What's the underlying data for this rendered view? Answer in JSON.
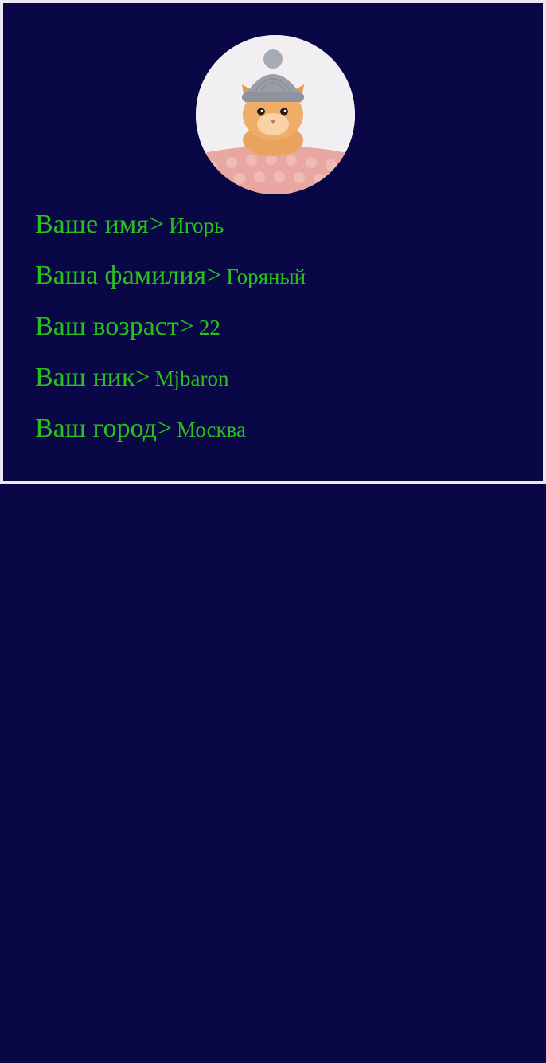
{
  "colors": {
    "background": "#0a0747",
    "accent_text": "#27c21b",
    "card_border": "#ece8f0"
  },
  "profile": {
    "avatar": {
      "icon": "kitten-with-hat-avatar"
    },
    "fields": [
      {
        "label": "Ваше имя>",
        "value": "Игорь"
      },
      {
        "label": "Ваша фамилия>",
        "value": "Горяный"
      },
      {
        "label": "Ваш возраст>",
        "value": "22"
      },
      {
        "label": "Ваш ник>",
        "value": "Mjbaron"
      },
      {
        "label": "Ваш город>",
        "value": "Москва"
      }
    ]
  }
}
